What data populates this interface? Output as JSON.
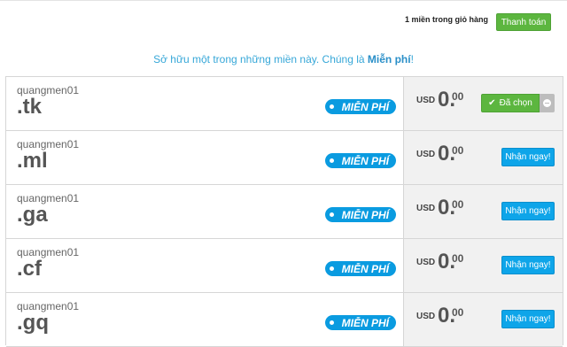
{
  "header": {
    "cart_text": "1 miền trong giỏ hàng",
    "checkout_label": "Thanh toán"
  },
  "tagline": {
    "prefix": "Sở hữu một trong những miền này. Chúng là ",
    "emph": "Miễn phí",
    "suffix": "!"
  },
  "domains": [
    {
      "name": "quangmen01",
      "tld": ".tk",
      "badge": "MIỄN PHÍ",
      "currency": "USD",
      "price_main": "0.",
      "price_cents": "00",
      "action": "Đã chọn",
      "selected": true
    },
    {
      "name": "quangmen01",
      "tld": ".ml",
      "badge": "MIỄN PHÍ",
      "currency": "USD",
      "price_main": "0.",
      "price_cents": "00",
      "action": "Nhận ngay!",
      "selected": false
    },
    {
      "name": "quangmen01",
      "tld": ".ga",
      "badge": "MIỄN PHÍ",
      "currency": "USD",
      "price_main": "0.",
      "price_cents": "00",
      "action": "Nhận ngay!",
      "selected": false
    },
    {
      "name": "quangmen01",
      "tld": ".cf",
      "badge": "MIỄN PHÍ",
      "currency": "USD",
      "price_main": "0.",
      "price_cents": "00",
      "action": "Nhận ngay!",
      "selected": false
    },
    {
      "name": "quangmen01",
      "tld": ".gq",
      "badge": "MIỄN PHÍ",
      "currency": "USD",
      "price_main": "0.",
      "price_cents": "00",
      "action": "Nhận ngay!",
      "selected": false
    }
  ],
  "colors": {
    "accent": "#0ea5e9",
    "success": "#5cb63f",
    "badge": "#0a9be0"
  }
}
